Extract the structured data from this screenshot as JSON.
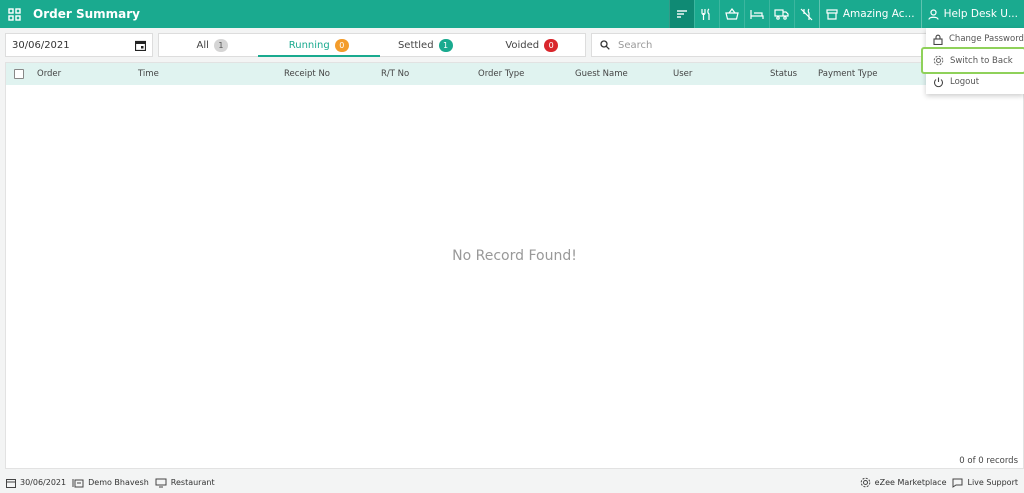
{
  "header": {
    "title": "Order Summary",
    "icons": [
      "sort-icon",
      "restaurant-icon",
      "basket-icon",
      "bed-icon",
      "truck-icon",
      "no-utensils-icon"
    ],
    "outlet_label": "Amazing Ac...",
    "user_label": "Help Desk U...",
    "accent_color": "#1aaa8f"
  },
  "filters": {
    "date": "30/06/2021",
    "tabs": [
      {
        "label": "All",
        "count": "1",
        "color": "#cccccc"
      },
      {
        "label": "Running",
        "count": "0",
        "color": "#f39c2b"
      },
      {
        "label": "Settled",
        "count": "1",
        "color": "#1aaa8f"
      },
      {
        "label": "Voided",
        "count": "0",
        "color": "#d9262c"
      }
    ],
    "active_tab": "Running",
    "search_placeholder": "Search"
  },
  "table": {
    "columns": [
      "Order",
      "Time",
      "Receipt No",
      "R/T No",
      "Order Type",
      "Guest Name",
      "User",
      "Status",
      "Payment Type"
    ],
    "empty_message": "No Record Found!",
    "records_text": "0 of 0 records"
  },
  "user_menu": {
    "items": [
      {
        "label": "Change Password",
        "icon": "lock-icon"
      },
      {
        "label": "Switch to Back",
        "icon": "gear-icon"
      },
      {
        "label": "Logout",
        "icon": "power-icon"
      }
    ],
    "highlighted": "Switch to Back"
  },
  "footer": {
    "date": "30/06/2021",
    "user": "Demo Bhavesh",
    "outlet_type": "Restaurant",
    "marketplace": "eZee Marketplace",
    "support": "Live Support"
  }
}
